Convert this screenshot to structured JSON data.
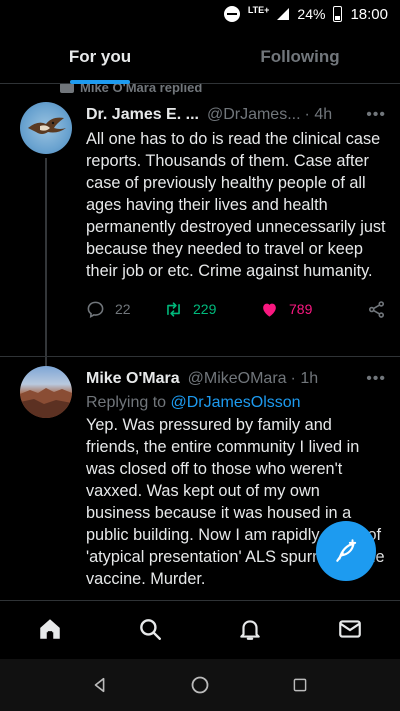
{
  "status_bar": {
    "network": "LTE+",
    "battery": "24%",
    "time": "18:00"
  },
  "tabs": [
    {
      "label": "For you",
      "active": true
    },
    {
      "label": "Following",
      "active": false
    }
  ],
  "reply_context": "Mike O'Mara replied",
  "tweets": [
    {
      "display_name": "Dr. James E. ...",
      "handle": "@DrJames...",
      "time": "· 4h",
      "more": "•••",
      "text": "All one has to do is read the clinical case reports. Thousands of them. Case after case of previously healthy people of all ages having their lives and health permanently destroyed unnecessarily just because they needed to travel or keep their job or etc. Crime against humanity.",
      "replies": "22",
      "retweets": "229",
      "likes": "789"
    },
    {
      "display_name": "Mike O'Mara",
      "handle": "@MikeOMara",
      "time": "· 1h",
      "more": "•••",
      "replying_prefix": "Replying to",
      "replying_to": "@DrJamesOlsson",
      "text": "Yep. Was pressured by family and friends, the entire community I lived in was closed off to those who weren't vaxxed. Was kept out of my own business because it was housed in a public building. Now I am rapidly dying of 'atypical presentation' ALS spurred by the vaccine. Murder."
    }
  ],
  "colors": {
    "accent": "#1d9bf0",
    "retweet": "#00ba7c",
    "like": "#f91880",
    "muted": "#71767b"
  },
  "icons": {
    "fab": "compose-feather-icon",
    "nav": [
      "home-icon",
      "search-icon",
      "bell-icon",
      "mail-icon"
    ],
    "system": [
      "back-icon",
      "home-circle-icon",
      "recents-icon"
    ]
  }
}
